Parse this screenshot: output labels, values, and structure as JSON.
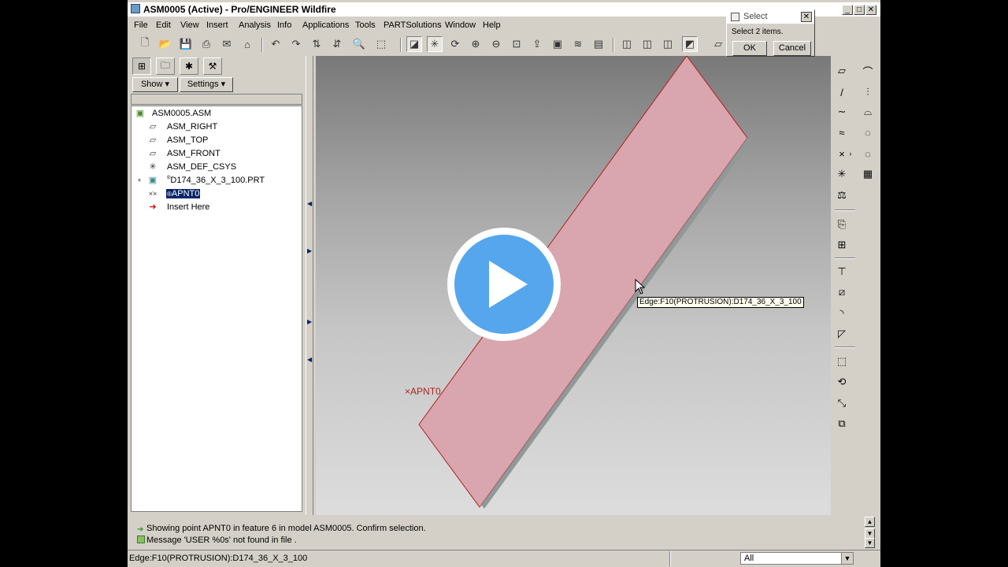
{
  "window": {
    "title": "ASM0005 (Active) - Pro/ENGINEER Wildfire",
    "controls": [
      "_",
      "□",
      "✕"
    ]
  },
  "menu": [
    "File",
    "Edit",
    "View",
    "Insert",
    "Analysis",
    "Info",
    "Applications",
    "Tools",
    "PARTSolutions",
    "Window",
    "Help"
  ],
  "toolbar_icons": [
    "new-file-icon",
    "open-folder-icon",
    "save-icon",
    "print-icon",
    "send-icon",
    "email-icon",
    "undo-icon",
    "redo-icon",
    "regenerate-icon",
    "regenerate-manager-icon",
    "find-icon",
    "selection-box-icon",
    "refit-icon",
    "spin-center-icon",
    "orient-mode-icon",
    "zoom-in-icon",
    "zoom-out-icon",
    "zoom-fit-icon",
    "reorient-icon",
    "saved-views-icon",
    "layers-icon",
    "view-manager-icon",
    "wireframe-icon",
    "hidden-line-icon",
    "no-hidden-icon",
    "shading-icon",
    "datum-plane-display-icon"
  ],
  "model_tree": {
    "show_label": "Show",
    "settings_label": "Settings",
    "items": [
      {
        "label": "ASM0005.ASM",
        "icon": "assembly-icon"
      },
      {
        "label": "ASM_RIGHT",
        "icon": "datum-plane-icon"
      },
      {
        "label": "ASM_TOP",
        "icon": "datum-plane-icon"
      },
      {
        "label": "ASM_FRONT",
        "icon": "datum-plane-icon"
      },
      {
        "label": "ASM_DEF_CSYS",
        "icon": "coordinate-system-icon"
      },
      {
        "label": "D174_36_X_3_100.PRT",
        "prefix": "®",
        "icon": "part-icon"
      },
      {
        "label": "APNT0",
        "prefix": "®",
        "icon": "datum-point-icon",
        "selected": true
      },
      {
        "label": "Insert Here",
        "icon": "insert-arrow-icon"
      }
    ]
  },
  "viewport": {
    "point_label": "APNT0",
    "tooltip": "Edge:F10(PROTRUSION):D174_36_X_3_100"
  },
  "select_dialog": {
    "title": "Select",
    "prompt": "Select 2 items.",
    "ok_label": "OK",
    "cancel_label": "Cancel"
  },
  "messages": [
    "Showing point APNT0 in feature 6 in model ASM0005. Confirm selection.",
    "Message 'USER %0s' not found in file ."
  ],
  "status": {
    "text": "Edge:F10(PROTRUSION):D174_36_X_3_100",
    "filter_value": "All"
  },
  "colors": {
    "part_fill": "#d9a5af",
    "part_edge": "#b02020",
    "selection_highlight": "#0a246a",
    "play_button": "#55a6ec"
  }
}
